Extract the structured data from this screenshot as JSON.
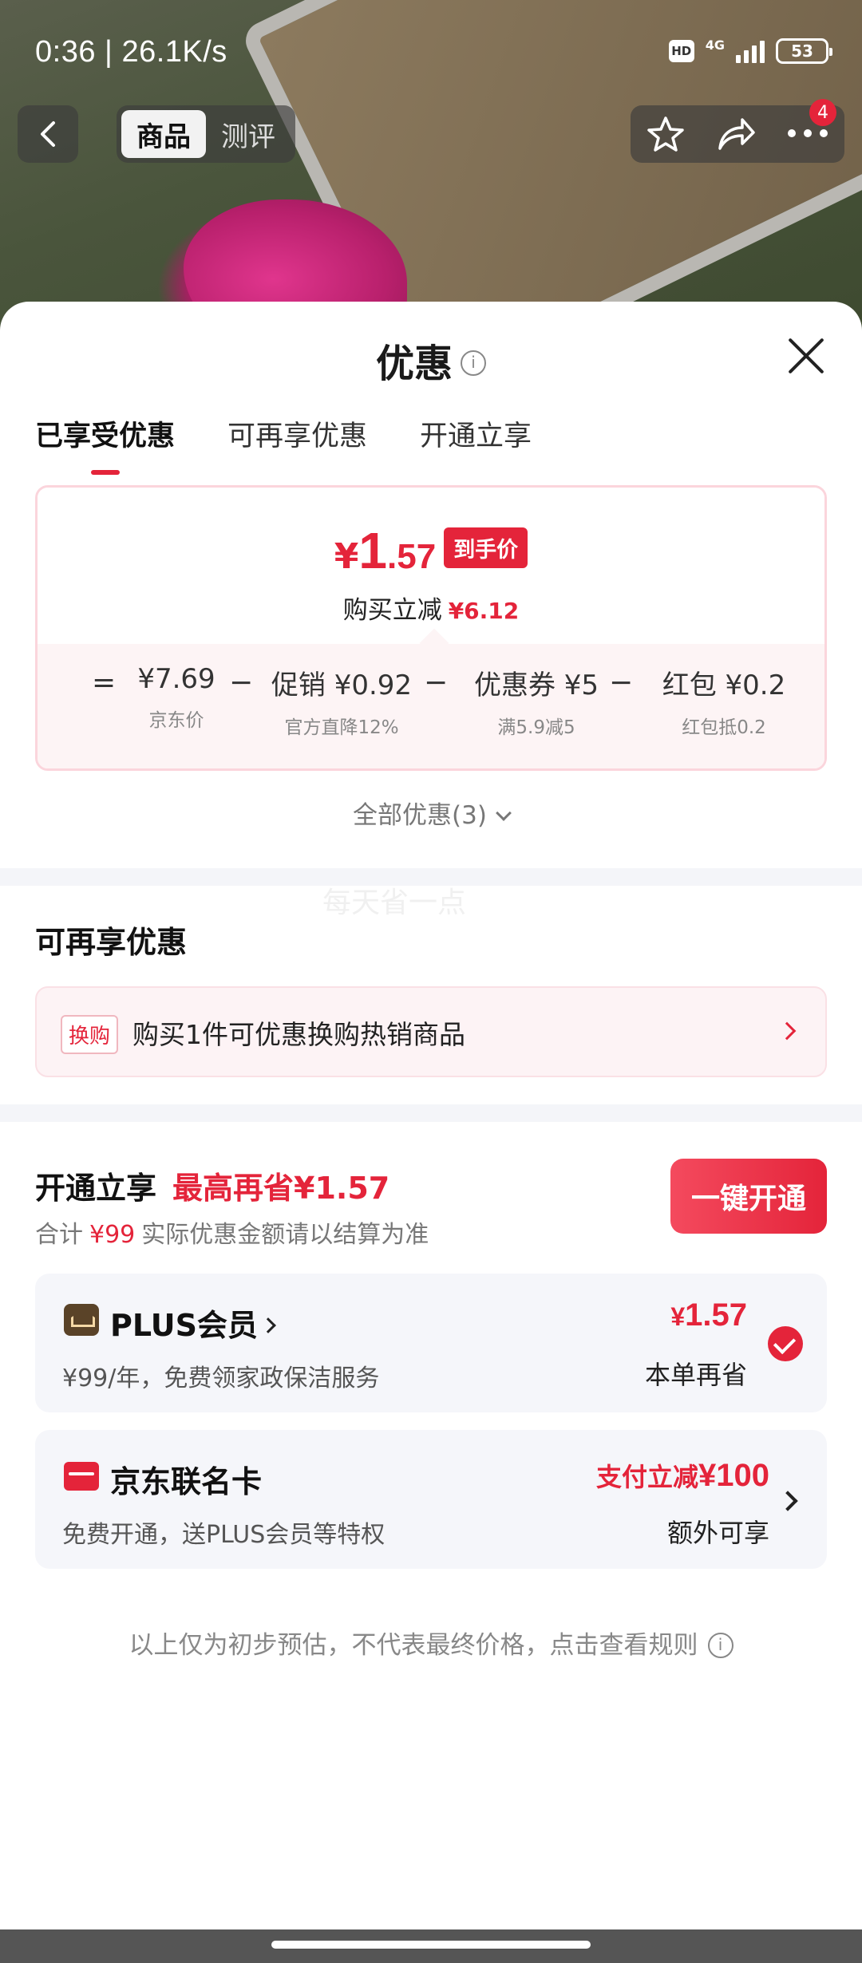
{
  "status_bar": {
    "time_speed": "0:36 | 26.1K/s",
    "hd": "HD",
    "network": "4G",
    "battery": "53"
  },
  "nav": {
    "tabs": [
      {
        "label": "商品",
        "active": true
      },
      {
        "label": "测评",
        "active": false
      }
    ],
    "more_badge": "4",
    "icons": [
      "back-icon",
      "star-icon",
      "share-icon",
      "more-icon"
    ]
  },
  "sheet": {
    "title": "优惠",
    "subtabs": [
      {
        "label": "已享受优惠",
        "active": true
      },
      {
        "label": "可再享优惠",
        "active": false
      },
      {
        "label": "开通立享",
        "active": false
      }
    ],
    "price_card": {
      "currency": "¥",
      "price_int": "1",
      "price_dec": ".57",
      "tag": "到手价",
      "save_label": "购买立减",
      "save_value": "¥6.12",
      "formula": [
        {
          "op": "=",
          "value": "¥7.69",
          "label": "京东价"
        },
        {
          "op": "−",
          "value": "促销 ¥0.92",
          "label": "官方直降12%"
        },
        {
          "op": "−",
          "value": "优惠券 ¥5",
          "label": "满5.9减5"
        },
        {
          "op": "−",
          "value": "红包 ¥0.2",
          "label": "红包抵0.2"
        }
      ]
    },
    "all_coupons": "全部优惠(3)",
    "more_section": {
      "title": "可再享优惠",
      "watermark": "每天省一点",
      "swap": {
        "tag": "换购",
        "text": "购买1件可优惠换购热销商品"
      }
    },
    "open_section": {
      "title": "开通立享",
      "highlight": "最高再省¥1.57",
      "sub_prefix": "合计",
      "sub_price": "¥99",
      "sub_suffix": "实际优惠金额请以结算为准",
      "button": "一键开通"
    },
    "plus_card": {
      "title": "PLUS会员",
      "desc": "¥99/年，免费领家政保洁服务",
      "price_yen": "¥",
      "price": "1.57",
      "save": "本单再省",
      "checked": true
    },
    "jd_card": {
      "title": "京东联名卡",
      "desc": "免费开通，送PLUS会员等特权",
      "promo_text": "支付立减",
      "promo_value": "¥100",
      "extra": "额外可享"
    },
    "note": "以上仅为初步预估，不代表最终价格，点击查看规则"
  },
  "colors": {
    "accent": "#e4243a",
    "card_bg": "#f5f6fa",
    "pink_bg": "#fdf4f5"
  }
}
